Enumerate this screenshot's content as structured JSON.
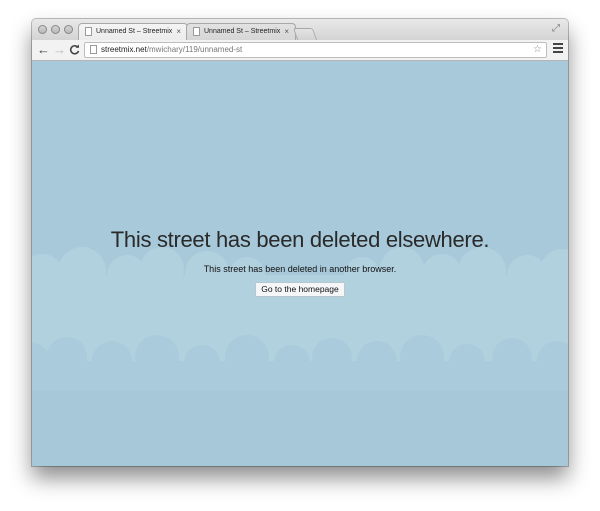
{
  "browser": {
    "tabs": [
      {
        "title": "Unnamed St – Streetmix",
        "close": "×",
        "active": true
      },
      {
        "title": "Unnamed St – Streetmix",
        "close": "×",
        "active": false
      }
    ],
    "url": {
      "host": "streetmix.net",
      "path": "/mwichary/119/unnamed-st"
    },
    "icons": {
      "back": "←",
      "forward": "→",
      "reload": "C",
      "star": "☆",
      "fullscreen": "⤢"
    }
  },
  "message": {
    "title": "This street has been deleted elsewhere.",
    "subtitle": "This street has been deleted in another browser.",
    "button": "Go to the homepage"
  },
  "colors": {
    "sky": "#a7c9d9",
    "cloud_back": "#b0d0df",
    "cloud_front": "#afcfdd"
  }
}
